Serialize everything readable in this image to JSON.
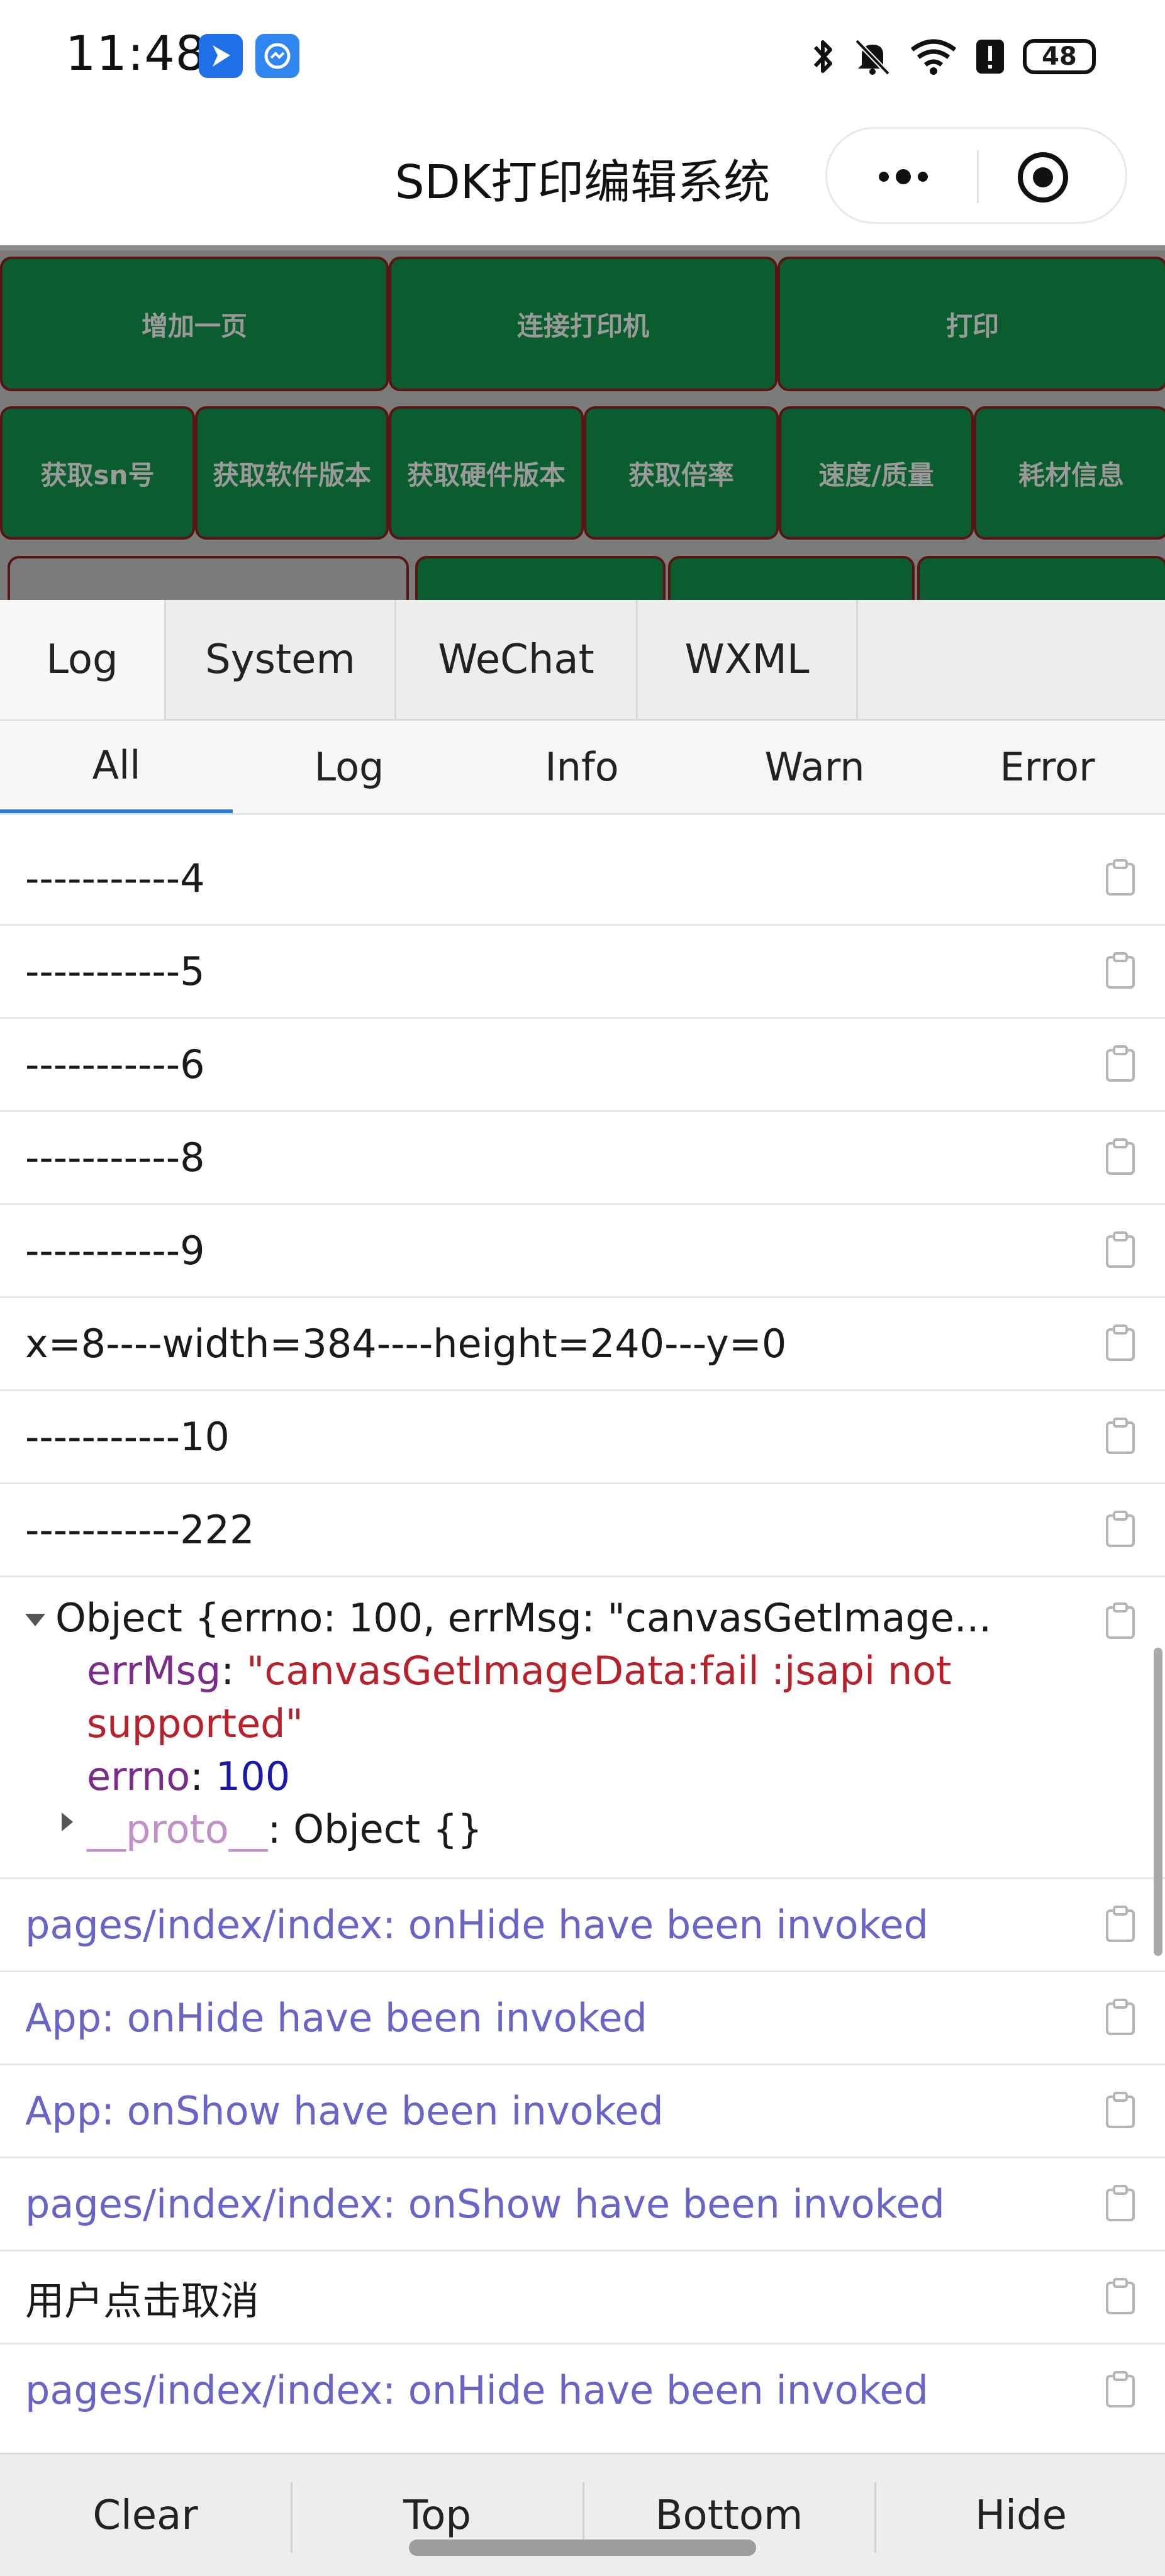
{
  "status_bar": {
    "time": "11:48",
    "battery": "48",
    "icons": [
      "bluetooth-icon",
      "mute-bell-icon",
      "wifi-icon",
      "alert-icon",
      "battery-icon"
    ]
  },
  "nav": {
    "title": "SDK打印编辑系统"
  },
  "app": {
    "row1": [
      "增加一页",
      "连接打印机",
      "打印"
    ],
    "row2": [
      "获取sn号",
      "获取软件版本",
      "获取硬件版本",
      "获取倍率",
      "速度/质量",
      "耗材信息"
    ],
    "colors": {
      "button_bg": "#0b5c2e",
      "button_border": "#5a1414",
      "button_text": "#9a9a9a",
      "area_bg": "#7b7b7b"
    }
  },
  "console": {
    "top_tabs": [
      "Log",
      "System",
      "WeChat",
      "WXML"
    ],
    "sub_tabs": [
      "All",
      "Log",
      "Info",
      "Warn",
      "Error"
    ],
    "logs": [
      "-----------4",
      "-----------5",
      "-----------6",
      "-----------8",
      "-----------9",
      "x=8----width=384----height=240---y=0",
      "-----------10",
      "-----------222"
    ],
    "object": {
      "summary": "Object {errno: 100, errMsg: \"canvasGetImage...",
      "errMsg_key": "errMsg",
      "errMsg_value_1": "\"canvasGetImageData:fail :jsapi not",
      "errMsg_value_2": "supported\"",
      "errno_key": "errno",
      "errno_value": "100",
      "proto_key": "__proto__",
      "proto_value": "Object {}",
      "sep": ": "
    },
    "logs_after": [
      {
        "text": "pages/index/index: onHide have been invoked",
        "style": "info"
      },
      {
        "text": "App: onHide have been invoked",
        "style": "info"
      },
      {
        "text": "App: onShow have been invoked",
        "style": "info"
      },
      {
        "text": "pages/index/index: onShow have been invoked",
        "style": "info"
      },
      {
        "text": "用户点击取消",
        "style": "log"
      },
      {
        "text": "pages/index/index: onHide have been invoked",
        "style": "info"
      }
    ],
    "toolbar": [
      "Clear",
      "Top",
      "Bottom",
      "Hide"
    ],
    "colors": {
      "info_text": "#6a63c8",
      "active_tab_underline": "#2d7bd6"
    }
  }
}
